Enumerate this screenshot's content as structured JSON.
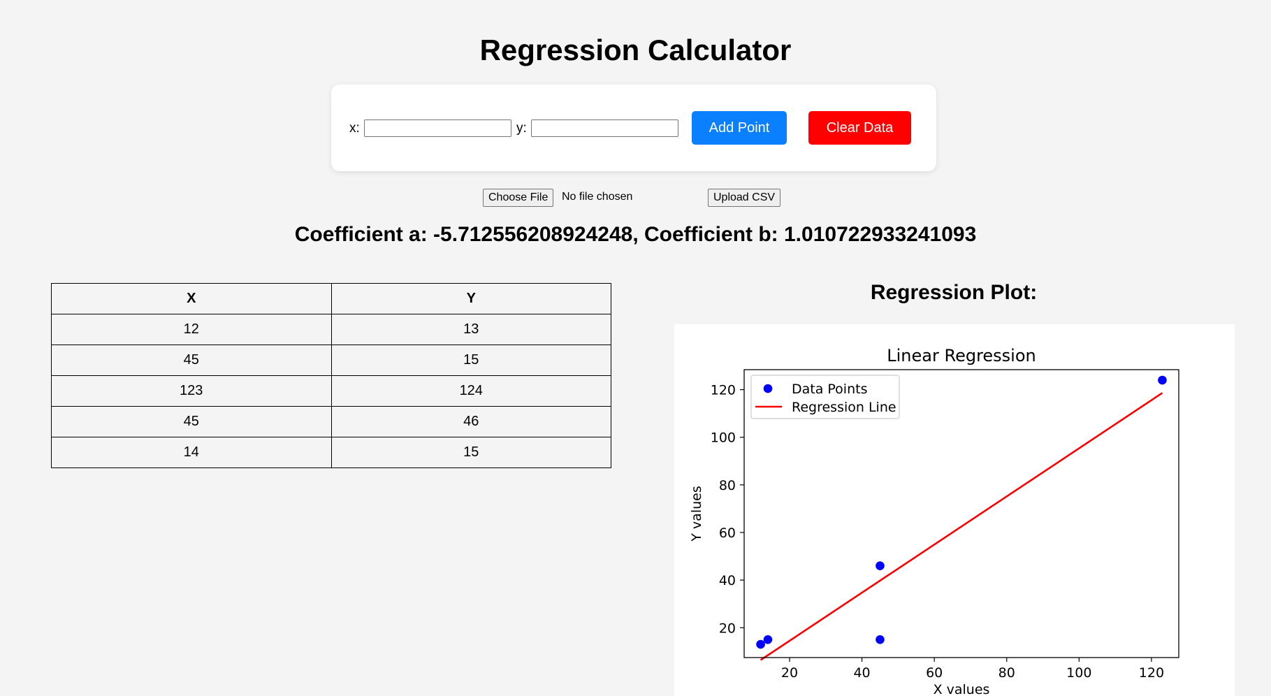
{
  "header": {
    "title": "Regression Calculator"
  },
  "form": {
    "x_label": "x:",
    "y_label": "y:",
    "x_value": "",
    "y_value": "",
    "add_button": "Add Point",
    "clear_button": "Clear Data"
  },
  "upload": {
    "choose_file_label": "Choose File",
    "file_status": "No file chosen",
    "upload_button": "Upload CSV"
  },
  "results": {
    "coefficients_text": "Coefficient a: -5.712556208924248, Coefficient b: 1.010722933241093"
  },
  "table": {
    "headers": [
      "X",
      "Y"
    ],
    "rows": [
      [
        "12",
        "13"
      ],
      [
        "45",
        "15"
      ],
      [
        "123",
        "124"
      ],
      [
        "45",
        "46"
      ],
      [
        "14",
        "15"
      ]
    ]
  },
  "plot": {
    "heading": "Regression Plot:"
  },
  "colors": {
    "add_button": "#0a80ff",
    "clear_button": "#ff0000",
    "points": "#0000ff",
    "line": "#ff0000"
  },
  "chart_data": {
    "type": "scatter",
    "title": "Linear Regression",
    "xlabel": "X values",
    "ylabel": "Y values",
    "xlim": [
      7.45,
      127.55
    ],
    "ylim": [
      7.45,
      128.4
    ],
    "xticks": [
      20,
      40,
      60,
      80,
      100,
      120
    ],
    "yticks": [
      20,
      40,
      60,
      80,
      100,
      120
    ],
    "grid": false,
    "legend_position": "upper left",
    "series": [
      {
        "name": "Data Points",
        "kind": "scatter",
        "color": "#0000ff",
        "x": [
          12,
          45,
          123,
          45,
          14
        ],
        "y": [
          13,
          15,
          124,
          46,
          15
        ]
      },
      {
        "name": "Regression Line",
        "kind": "line",
        "color": "#ff0000",
        "x": [
          12,
          123
        ],
        "y": [
          6.42,
          118.61
        ]
      }
    ]
  }
}
